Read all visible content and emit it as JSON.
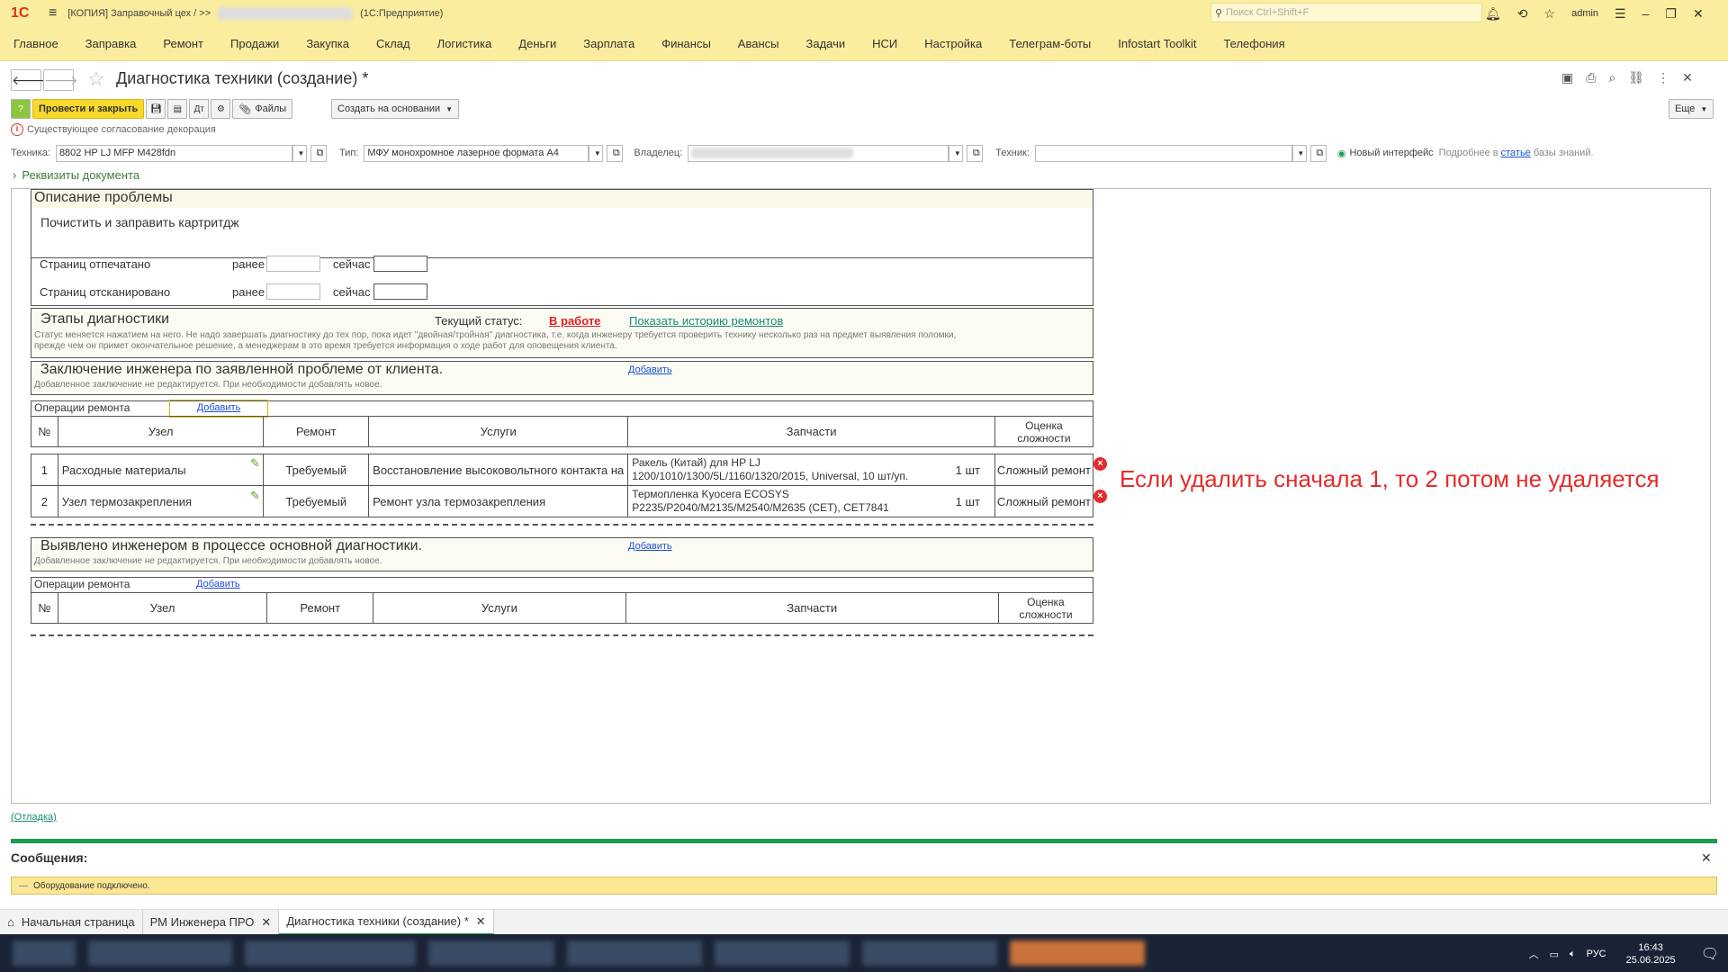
{
  "titlebar": {
    "logo": "1С",
    "title": "[КОПИЯ] Заправочный цех /  >>",
    "app": "(1С:Предприятие)",
    "search_placeholder": "Поиск Ctrl+Shift+F",
    "user": "admin"
  },
  "menu": [
    "Главное",
    "Заправка",
    "Ремонт",
    "Продажи",
    "Закупка",
    "Склад",
    "Логистика",
    "Деньги",
    "Зарплата",
    "Финансы",
    "Авансы",
    "Задачи",
    "НСИ",
    "Настройка",
    "Телеграм-боты",
    "Infostart Toolkit",
    "Телефония"
  ],
  "page": {
    "title": "Диагностика техники (создание) *",
    "more": "Еще"
  },
  "toolbar": {
    "post_close": "Провести и закрыть",
    "files": "Файлы",
    "create_based": "Создать на основании"
  },
  "warning": "Существующее согласование декорация",
  "fields": {
    "tech_label": "Техника:",
    "tech_value": "8802 HP  LJ MFP M428fdn",
    "type_label": "Тип:",
    "type_value": "МФУ монохромное лазерное формата А4",
    "owner_label": "Владелец:",
    "technician_label": "Техник:",
    "new_ui": "Новый интерфейс",
    "more_info_prefix": "Подробнее в",
    "more_info_link": "статье",
    "more_info_suffix": "базы знаний."
  },
  "requisites": "Реквизиты документа",
  "problem": {
    "title": "Описание проблемы",
    "text": "Почистить и заправить картритдж",
    "printed": "Страниц отпечатано",
    "scanned": "Страниц отсканировано",
    "before": "ранее",
    "now": "сейчас"
  },
  "stages": {
    "title": "Этапы диагностики",
    "status_label": "Текущий статус:",
    "status_value": "В работе",
    "history_link": "Показать историю ремонтов",
    "note1": "Статус меняется нажатием на него. Не надо завершать диагностику до тех пор, пока идет \"двойная/тройная\" диагностика, т.е. когда инженеру требуется проверить технику несколько раз на предмет выявления поломки,",
    "note2": "прежде чем он примет окончательное решение, а менеджерам в это время требуется информация о ходе работ для оповещения клиента."
  },
  "conclusion": {
    "title": "Заключение инженера по заявленной проблеме от клиента.",
    "add": "Добавить",
    "note": "Добавленное заключение не редактируется. При необходимости добавлять новое."
  },
  "ops1": {
    "label": "Операции ремонта",
    "add": "Добавить",
    "headers": [
      "№",
      "Узел",
      "Ремонт",
      "Услуги",
      "Запчасти",
      "Оценка сложности"
    ],
    "rows": [
      {
        "n": "1",
        "node": "Расходные материалы",
        "repair": "Требуемый",
        "service": "Восстановление высоковольтного контакта на",
        "parts1": "Ракель (Китай) для HP LJ",
        "parts2": "1200/1010/1300/5L/1160/1320/2015, Universal, 10 шт/уп.",
        "qty": "1 шт",
        "complexity": "Сложный ремонт"
      },
      {
        "n": "2",
        "node": "Узел термозакрепления",
        "repair": "Требуемый",
        "service": "Ремонт узла термозакрепления",
        "parts1": "Термопленка Kyocera ECOSYS",
        "parts2": "P2235/P2040/M2135/M2540/M2635 (CET), CET7841",
        "qty": "1 шт",
        "complexity": "Сложный ремонт"
      }
    ]
  },
  "annotation": "Если удалить сначала 1, то 2 потом не удаляется",
  "found": {
    "title": "Выявлено инженером в процессе основной диагностики.",
    "add": "Добавить",
    "note": "Добавленное заключение не редактируется. При необходимости добавлять новое."
  },
  "ops2": {
    "label": "Операции ремонта",
    "add": "Добавить",
    "headers": [
      "№",
      "Узел",
      "Ремонт",
      "Услуги",
      "Запчасти",
      "Оценка сложности"
    ]
  },
  "debug": "(Отладка)",
  "messages": {
    "title": "Сообщения:",
    "line": "Оборудование подключено."
  },
  "tabs": [
    "Начальная страница",
    "РМ Инженера ПРО",
    "Диагностика техники (создание) *"
  ],
  "tray": {
    "lang": "РУС",
    "time": "16:43",
    "date": "25.06.2025"
  }
}
